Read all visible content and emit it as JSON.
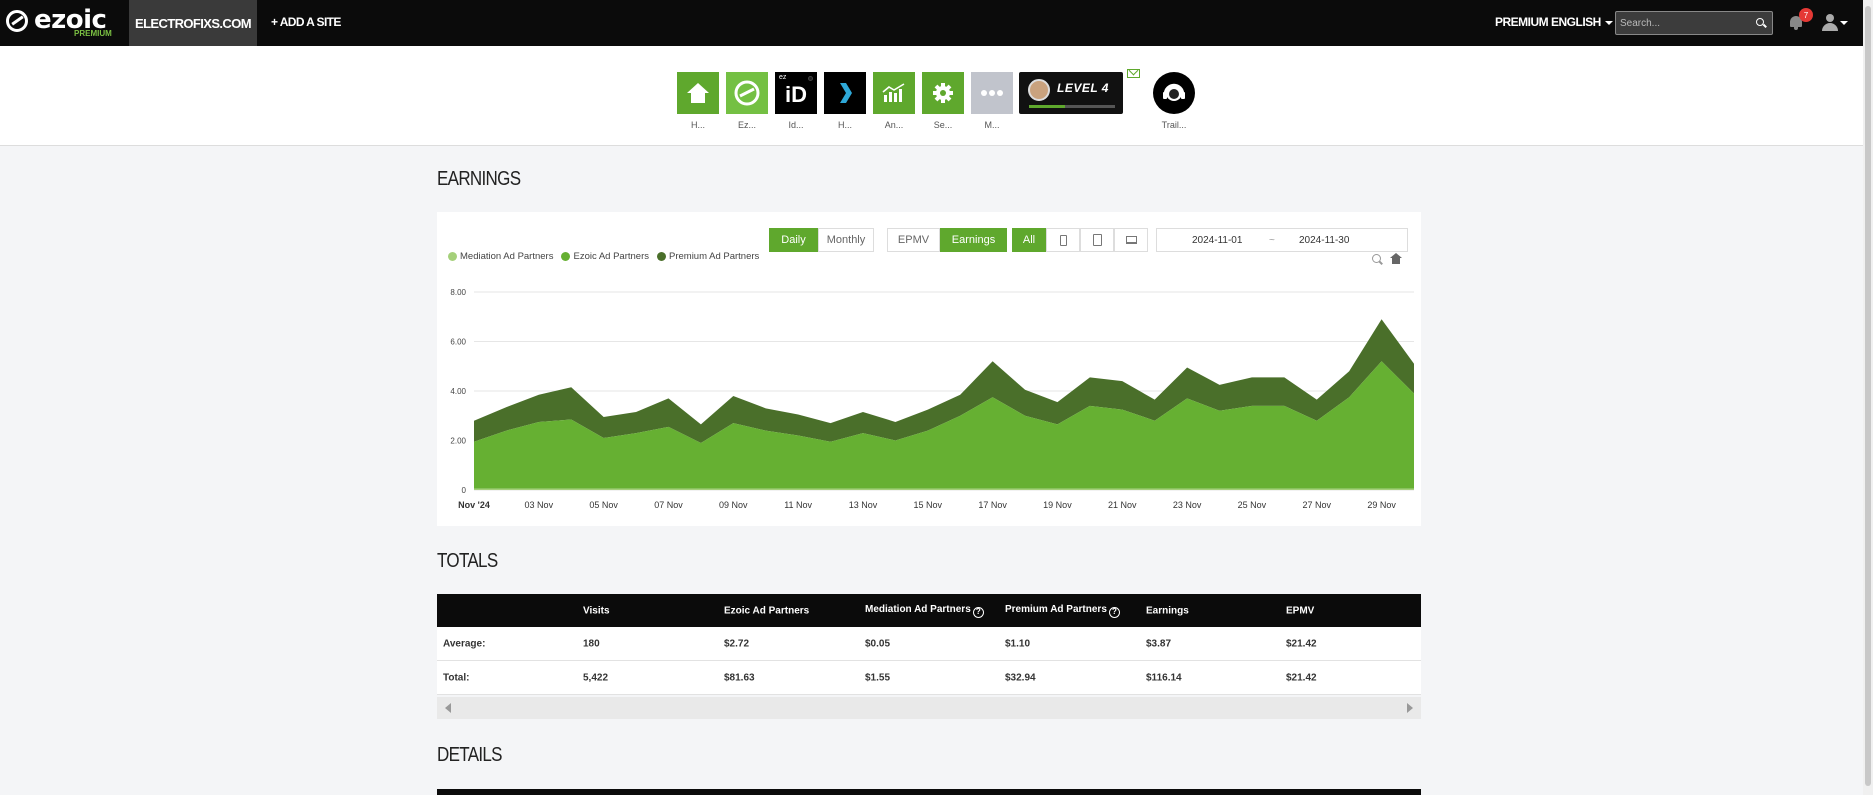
{
  "topbar": {
    "logo": "ezoic",
    "logo_sub": "PREMIUM",
    "site": "ELECTROFIXS.COM",
    "add_site": "+ ADD A SITE",
    "premium": "PREMIUM",
    "language": "ENGLISH",
    "search_placeholder": "Search...",
    "notifications": "7"
  },
  "tools": [
    {
      "label": "H...",
      "icon": "home-icon"
    },
    {
      "label": "Ez...",
      "icon": "ezoic-logo-icon"
    },
    {
      "label": "Id...",
      "icon": "ezid-icon"
    },
    {
      "label": "H...",
      "icon": "chevron-right-icon"
    },
    {
      "label": "An...",
      "icon": "analytics-icon"
    },
    {
      "label": "Se...",
      "icon": "gear-icon"
    },
    {
      "label": "M...",
      "icon": "more-icon"
    }
  ],
  "level": {
    "label": "LEVEL 4",
    "progress": 0.42
  },
  "trail": {
    "label": "Trail..."
  },
  "sections": {
    "earnings": "EARNINGS",
    "totals": "TOTALS",
    "details": "DETAILS"
  },
  "controls": {
    "daily": "Daily",
    "monthly": "Monthly",
    "epmv": "EPMV",
    "earnings": "Earnings",
    "all": "All",
    "date_from": "2024-11-01",
    "date_sep": "~",
    "date_to": "2024-11-30"
  },
  "colors": {
    "mediation": "#a5d07a",
    "ezoic": "#66b032",
    "premium": "#4a6f2a",
    "accent": "#5fa82d"
  },
  "chart_data": {
    "type": "area",
    "stacked": true,
    "x": [
      "Nov '24",
      "02 Nov",
      "03 Nov",
      "04 Nov",
      "05 Nov",
      "06 Nov",
      "07 Nov",
      "08 Nov",
      "09 Nov",
      "10 Nov",
      "11 Nov",
      "12 Nov",
      "13 Nov",
      "14 Nov",
      "15 Nov",
      "16 Nov",
      "17 Nov",
      "18 Nov",
      "19 Nov",
      "20 Nov",
      "21 Nov",
      "22 Nov",
      "23 Nov",
      "24 Nov",
      "25 Nov",
      "26 Nov",
      "27 Nov",
      "28 Nov",
      "29 Nov",
      "30 Nov"
    ],
    "xticks": [
      "Nov '24",
      "03 Nov",
      "05 Nov",
      "07 Nov",
      "09 Nov",
      "11 Nov",
      "13 Nov",
      "15 Nov",
      "17 Nov",
      "19 Nov",
      "21 Nov",
      "23 Nov",
      "25 Nov",
      "27 Nov",
      "29 Nov"
    ],
    "yticks": [
      "0",
      "2.00",
      "4.00",
      "6.00",
      "8.00"
    ],
    "ylim": [
      0,
      8
    ],
    "series": [
      {
        "name": "Mediation Ad Partners",
        "values": [
          0.05,
          0.05,
          0.05,
          0.05,
          0.05,
          0.05,
          0.05,
          0.05,
          0.05,
          0.05,
          0.05,
          0.05,
          0.05,
          0.05,
          0.05,
          0.05,
          0.05,
          0.05,
          0.05,
          0.05,
          0.05,
          0.05,
          0.05,
          0.05,
          0.05,
          0.05,
          0.05,
          0.05,
          0.05,
          0.05
        ]
      },
      {
        "name": "Ezoic Ad Partners",
        "values": [
          1.9,
          2.35,
          2.7,
          2.8,
          2.05,
          2.25,
          2.5,
          1.85,
          2.65,
          2.35,
          2.15,
          1.9,
          2.25,
          1.95,
          2.35,
          2.95,
          3.7,
          2.95,
          2.6,
          3.35,
          3.2,
          2.75,
          3.65,
          3.15,
          3.35,
          3.35,
          2.75,
          3.7,
          5.15,
          3.85
        ]
      },
      {
        "name": "Premium Ad Partners",
        "values": [
          0.85,
          0.95,
          1.1,
          1.3,
          0.85,
          0.85,
          1.15,
          0.75,
          1.1,
          0.9,
          0.85,
          0.75,
          0.85,
          0.75,
          0.85,
          0.85,
          1.45,
          1.05,
          0.9,
          1.15,
          1.15,
          0.85,
          1.25,
          1.05,
          1.15,
          1.15,
          0.85,
          1.05,
          1.7,
          1.2
        ]
      }
    ]
  },
  "totals": {
    "headers": [
      "Visits",
      "Ezoic Ad Partners",
      "Mediation Ad Partners",
      "Premium Ad Partners",
      "Earnings",
      "EPMV"
    ],
    "rows": [
      {
        "label": "Average:",
        "values": [
          "180",
          "$2.72",
          "$0.05",
          "$1.10",
          "$3.87",
          "$21.42"
        ]
      },
      {
        "label": "Total:",
        "values": [
          "5,422",
          "$81.63",
          "$1.55",
          "$32.94",
          "$116.14",
          "$21.42"
        ]
      }
    ]
  }
}
